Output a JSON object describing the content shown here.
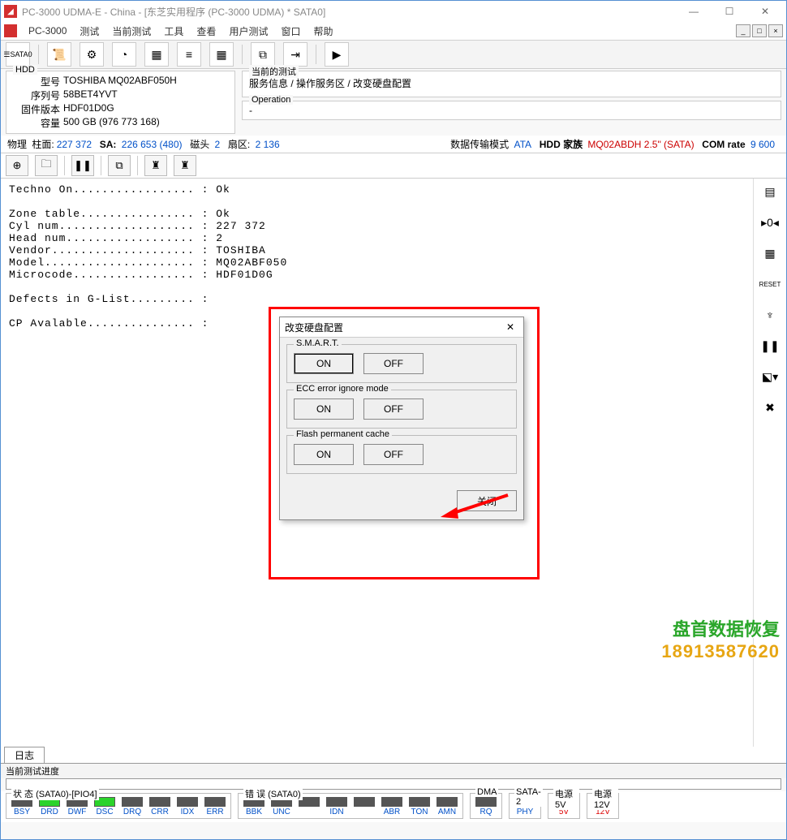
{
  "window": {
    "title": "PC-3000 UDMA-E - China - [东芝实用程序 (PC-3000 UDMA) * SATA0]"
  },
  "menus": {
    "app": "PC-3000",
    "items": [
      "测试",
      "当前测试",
      "工具",
      "查看",
      "用户测试",
      "窗口",
      "帮助"
    ]
  },
  "toolbar": {
    "sata": "SATA0"
  },
  "hdd": {
    "group": "HDD",
    "k_model": "型号",
    "v_model": "TOSHIBA MQ02ABF050H",
    "k_serial": "序列号",
    "v_serial": "58BET4YVT",
    "k_fw": "固件版本",
    "v_fw": "HDF01D0G",
    "k_cap": "容量",
    "v_cap": "500 GB (976 773 168)"
  },
  "test": {
    "group": "当前的测试",
    "path": "服务信息 / 操作服务区 / 改变硬盘配置",
    "op_group": "Operation",
    "op_dash": "-"
  },
  "status": {
    "phys": "物理",
    "cyl_lbl": "柱面:",
    "cyl": "227 372",
    "sa_lbl": "SA:",
    "sa": "226 653 (480)",
    "head_lbl": "磁头",
    "head": "2",
    "sect_lbl": "扇区:",
    "sect": "2 136",
    "xfer_lbl": "数据传输模式",
    "xfer": "ATA",
    "fam_lbl": "HDD 家族",
    "fam": "MQ02ABDH 2.5\" (SATA)",
    "com_lbl": "COM rate",
    "com": "9 600"
  },
  "log": {
    "l1k": "Techno On................. :",
    "l1v": "Ok",
    "l2k": "Zone table................ :",
    "l2v": "Ok",
    "l3k": "Cyl num................... :",
    "l3v": "227 372",
    "l4k": "Head num.................. :",
    "l4v": "2",
    "l5k": "Vendor.................... :",
    "l5v": "TOSHIBA",
    "l6k": "Model..................... :",
    "l6v": "MQ02ABF050",
    "l7k": "Microcode................. :",
    "l7v": "HDF01D0G",
    "l8k": "Defects in G-List......... :",
    "l8v": "",
    "l9k": "CP Avalable............... :",
    "l9v": ""
  },
  "dlg": {
    "title": "改变硬盘配置",
    "g1": "S.M.A.R.T.",
    "g2": "ECC error ignore mode",
    "g3": "Flash permanent cache",
    "on": "ON",
    "off": "OFF",
    "close": "关闭"
  },
  "tabs": {
    "log": "日志"
  },
  "progress": {
    "label": "当前测试进度"
  },
  "bottom": {
    "g_status": "状 态 (SATA0)-[PIO4]",
    "g_err": "错 误 (SATA0)",
    "g_dma": "DMA",
    "g_sata2": "SATA-2",
    "g_5v": "电源 5V",
    "g_12v": "电源 12V",
    "st": [
      "BSY",
      "DRD",
      "DWF",
      "DSC",
      "DRQ",
      "CRR",
      "IDX",
      "ERR"
    ],
    "er": [
      "BBK",
      "UNC",
      "",
      "IDN",
      "",
      "ABR",
      "TON",
      "AMN"
    ],
    "dma": [
      "RQ"
    ],
    "s2": [
      "PHY"
    ],
    "p5": [
      "5V"
    ],
    "p12": [
      "12V"
    ]
  },
  "wm": {
    "t1": "盘首数据恢复",
    "t2": "18913587620"
  }
}
